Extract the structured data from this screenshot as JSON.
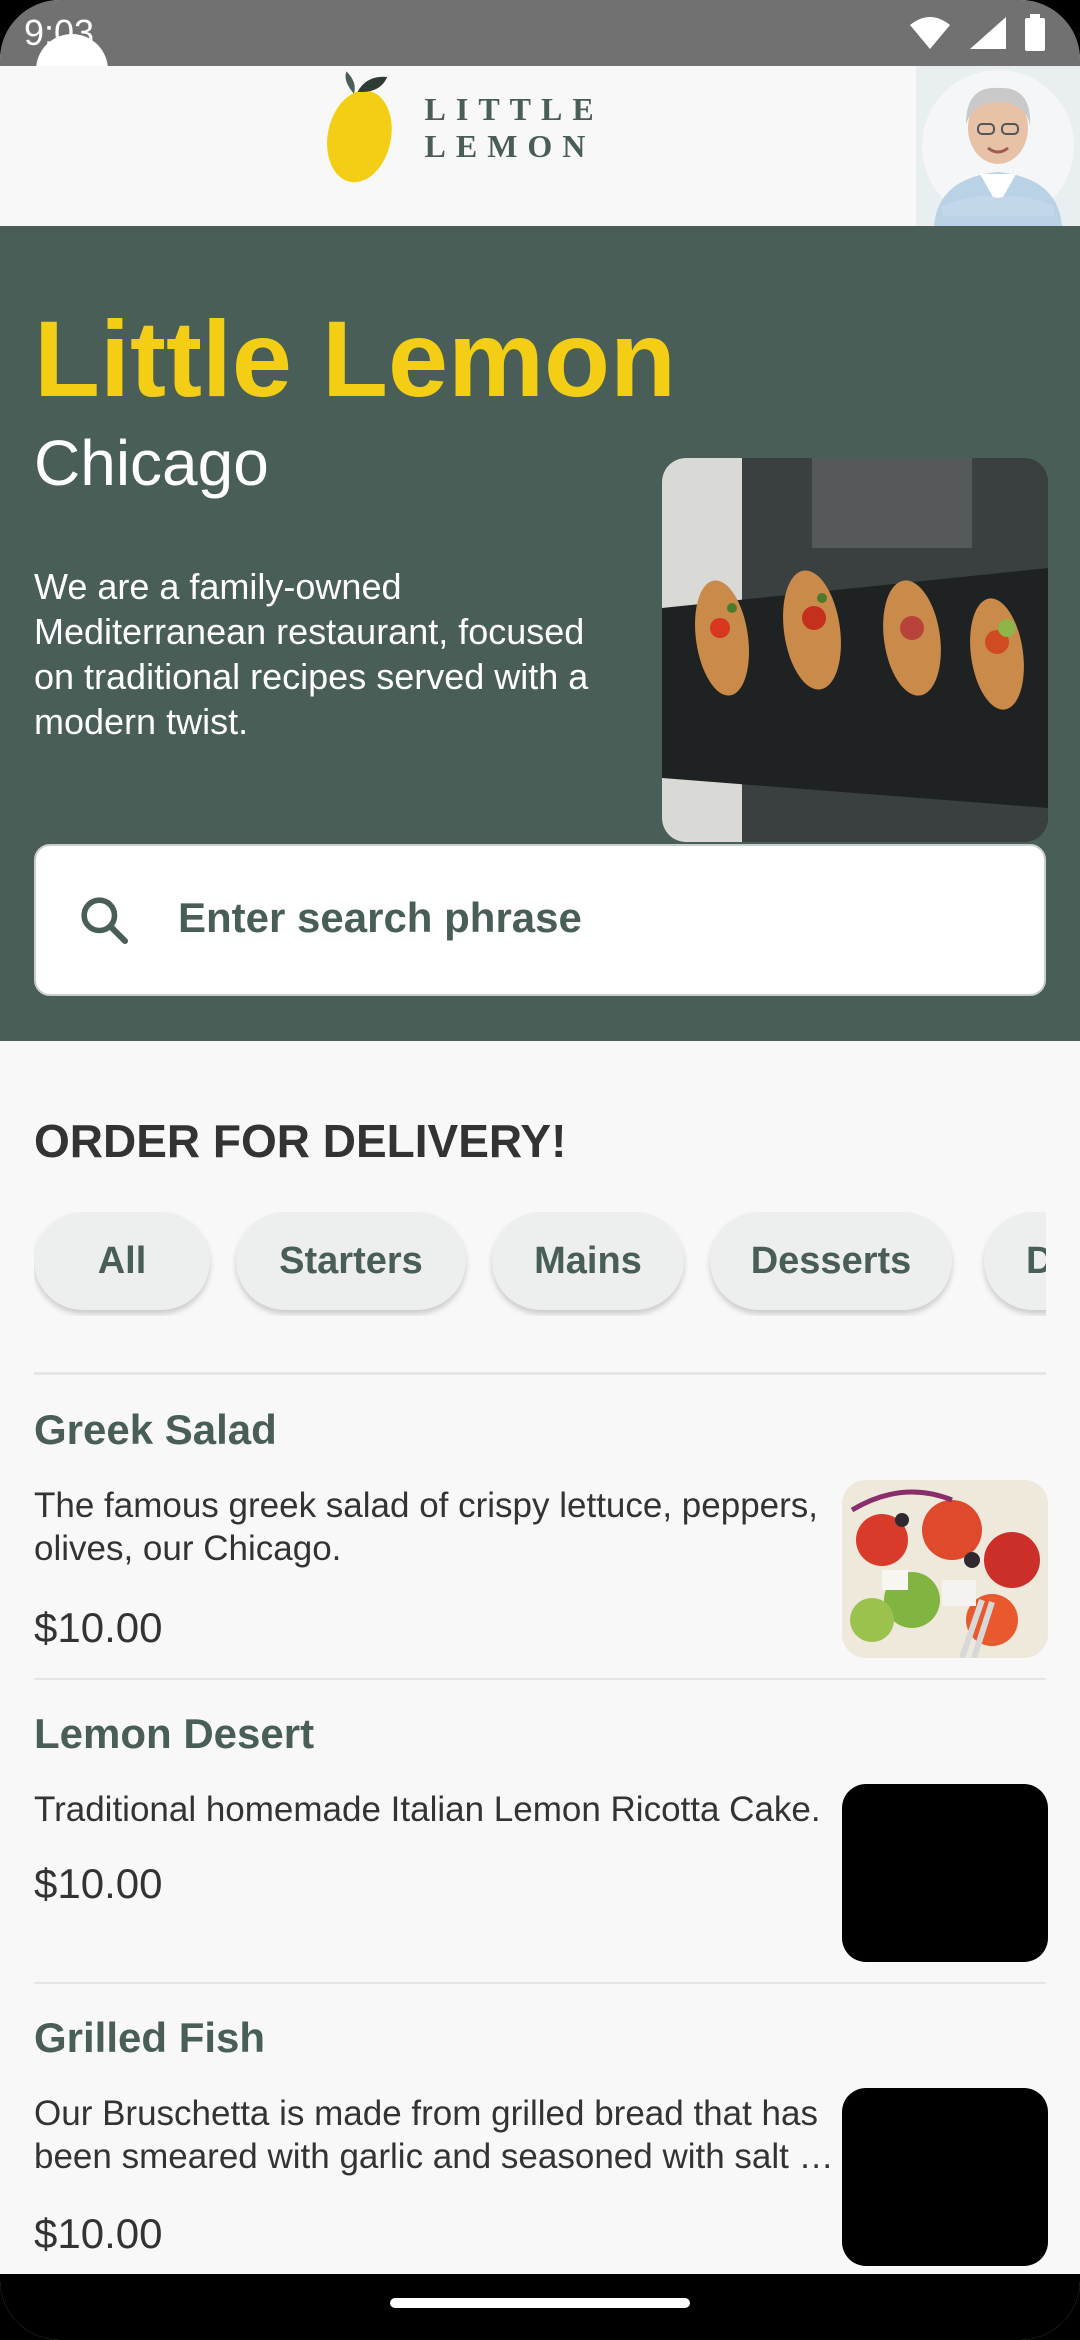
{
  "status_bar": {
    "time": "9:03",
    "icons": [
      "wifi-icon",
      "signal-icon",
      "battery-icon"
    ]
  },
  "app_bar": {
    "brand": "LITTLE LEMON",
    "profile_icon": "avatar"
  },
  "hero": {
    "title": "Little Lemon",
    "city": "Chicago",
    "description": "We are a family-owned Mediterranean restaurant, focused on traditional recipes served with a modern twist.",
    "search_placeholder": "Enter search phrase"
  },
  "order": {
    "heading": "ORDER FOR DELIVERY!",
    "categories": [
      "All",
      "Starters",
      "Mains",
      "Desserts",
      "D"
    ]
  },
  "menu": [
    {
      "title": "Greek Salad",
      "description": "The famous greek salad of crispy lettuce, peppers, olives, our Chicago.",
      "price": "$10.00"
    },
    {
      "title": "Lemon Desert",
      "description": "Traditional homemade Italian Lemon Ricotta Cake.",
      "price": "$10.00"
    },
    {
      "title": "Grilled Fish",
      "description": "Our Bruschetta is made from grilled bread that has been smeared with garlic and seasoned with salt …",
      "price": "$10.00"
    }
  ],
  "colors": {
    "primary_green": "#495e57",
    "primary_yellow": "#f4ce14",
    "background": "#f8f8f8"
  }
}
